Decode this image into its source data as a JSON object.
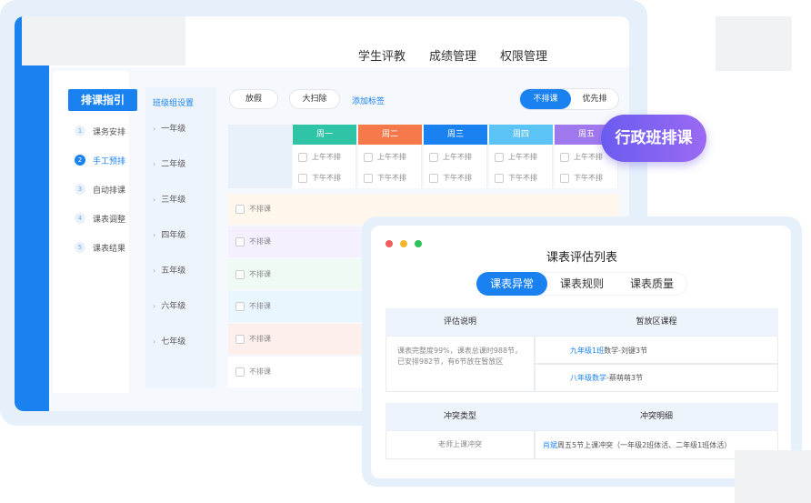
{
  "top_nav": [
    "学生评教",
    "成绩管理",
    "权限管理"
  ],
  "steps": {
    "title": "排课指引",
    "items": [
      {
        "num": "1",
        "label": "课务安排"
      },
      {
        "num": "2",
        "label": "手工预排"
      },
      {
        "num": "3",
        "label": "自动排课"
      },
      {
        "num": "4",
        "label": "课表调整"
      },
      {
        "num": "5",
        "label": "课表结果"
      }
    ],
    "active_index": 1
  },
  "grades": {
    "title": "班级组设置",
    "items": [
      "一年级",
      "二年级",
      "三年级",
      "四年级",
      "五年级",
      "六年级",
      "七年级"
    ]
  },
  "toolbar": {
    "holiday": "放假",
    "cleanup": "大扫除",
    "add_tag": "添加标签",
    "toggle_on": "不排课",
    "toggle_off": "优先排"
  },
  "days": [
    {
      "label": "周一",
      "color": "#2ec4a5"
    },
    {
      "label": "周二",
      "color": "#f5794a"
    },
    {
      "label": "周三",
      "color": "#1a82f0"
    },
    {
      "label": "周四",
      "color": "#5bc4f5"
    },
    {
      "label": "周五",
      "color": "#a078ee"
    }
  ],
  "slot_labels": {
    "am": "上午不排",
    "pm": "下午不排"
  },
  "row_label": "不排课",
  "row_colors": [
    "#fff6ec",
    "#f4f0fd",
    "#eefaf3",
    "#eaf6fd",
    "#fdf0ec",
    "#ffffff"
  ],
  "badge": "行政班排课",
  "eval": {
    "title": "课表评估列表",
    "tabs": [
      "课表异常",
      "课表规则",
      "课表质量"
    ],
    "active_tab": 0,
    "head1": {
      "left": "评估说明",
      "right": "暂放区课程"
    },
    "desc": "课表完整度99%，课表总课时988节，已安排982节，有6节放在暂放区",
    "courses": [
      {
        "hl": "九年级1班",
        "rest": "数学-刘键3节"
      },
      {
        "hl": "八年级数学",
        "rest": "-蔡萌萌3节"
      }
    ],
    "head2": {
      "left": "冲突类型",
      "right": "冲突明细"
    },
    "conflict_type": "老师上课冲突",
    "conflict_detail": {
      "hl": "肖斌",
      "rest": "周五5节上课冲突（一年级2班体活、二年级1班体活）"
    }
  }
}
